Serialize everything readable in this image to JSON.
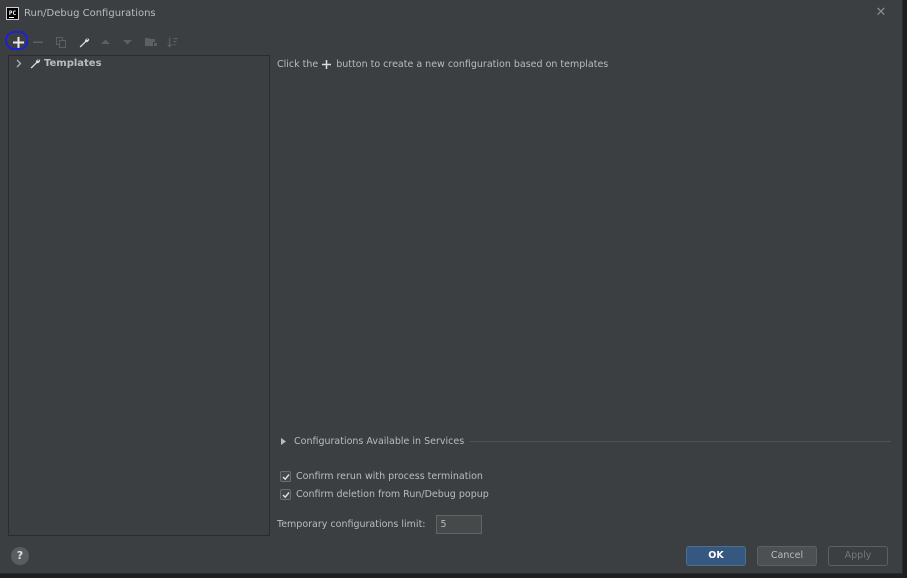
{
  "window": {
    "title": "Run/Debug Configurations",
    "app_logo_text": "PC",
    "close_glyph": "✕"
  },
  "toolbar": {
    "buttons": [
      {
        "name": "add-icon",
        "enabled": true
      },
      {
        "name": "remove-icon",
        "enabled": false
      },
      {
        "name": "copy-icon",
        "enabled": false
      },
      {
        "name": "wrench-icon",
        "enabled": true
      },
      {
        "name": "move-up-icon",
        "enabled": false
      },
      {
        "name": "move-down-icon",
        "enabled": false
      },
      {
        "name": "folder-icon",
        "enabled": false
      },
      {
        "name": "sort-icon",
        "enabled": false
      }
    ]
  },
  "tree": {
    "items": [
      {
        "label": "Templates",
        "icon": "wrench-icon",
        "expanded": false
      }
    ]
  },
  "content": {
    "hint_before": "Click the",
    "hint_after": "button to create a new configuration based on templates",
    "services_label": "Configurations Available in Services",
    "checkboxes": [
      {
        "label": "Confirm rerun with process termination",
        "checked": true
      },
      {
        "label": "Confirm deletion from Run/Debug popup",
        "checked": true
      }
    ],
    "limit_label": "Temporary configurations limit:",
    "limit_value": "5"
  },
  "footer": {
    "help_label": "?",
    "ok_label": "OK",
    "cancel_label": "Cancel",
    "apply_label": "Apply"
  },
  "colors": {
    "background": "#3c3f41",
    "primary_button": "#365880",
    "annotation": "#1f1fd6"
  }
}
